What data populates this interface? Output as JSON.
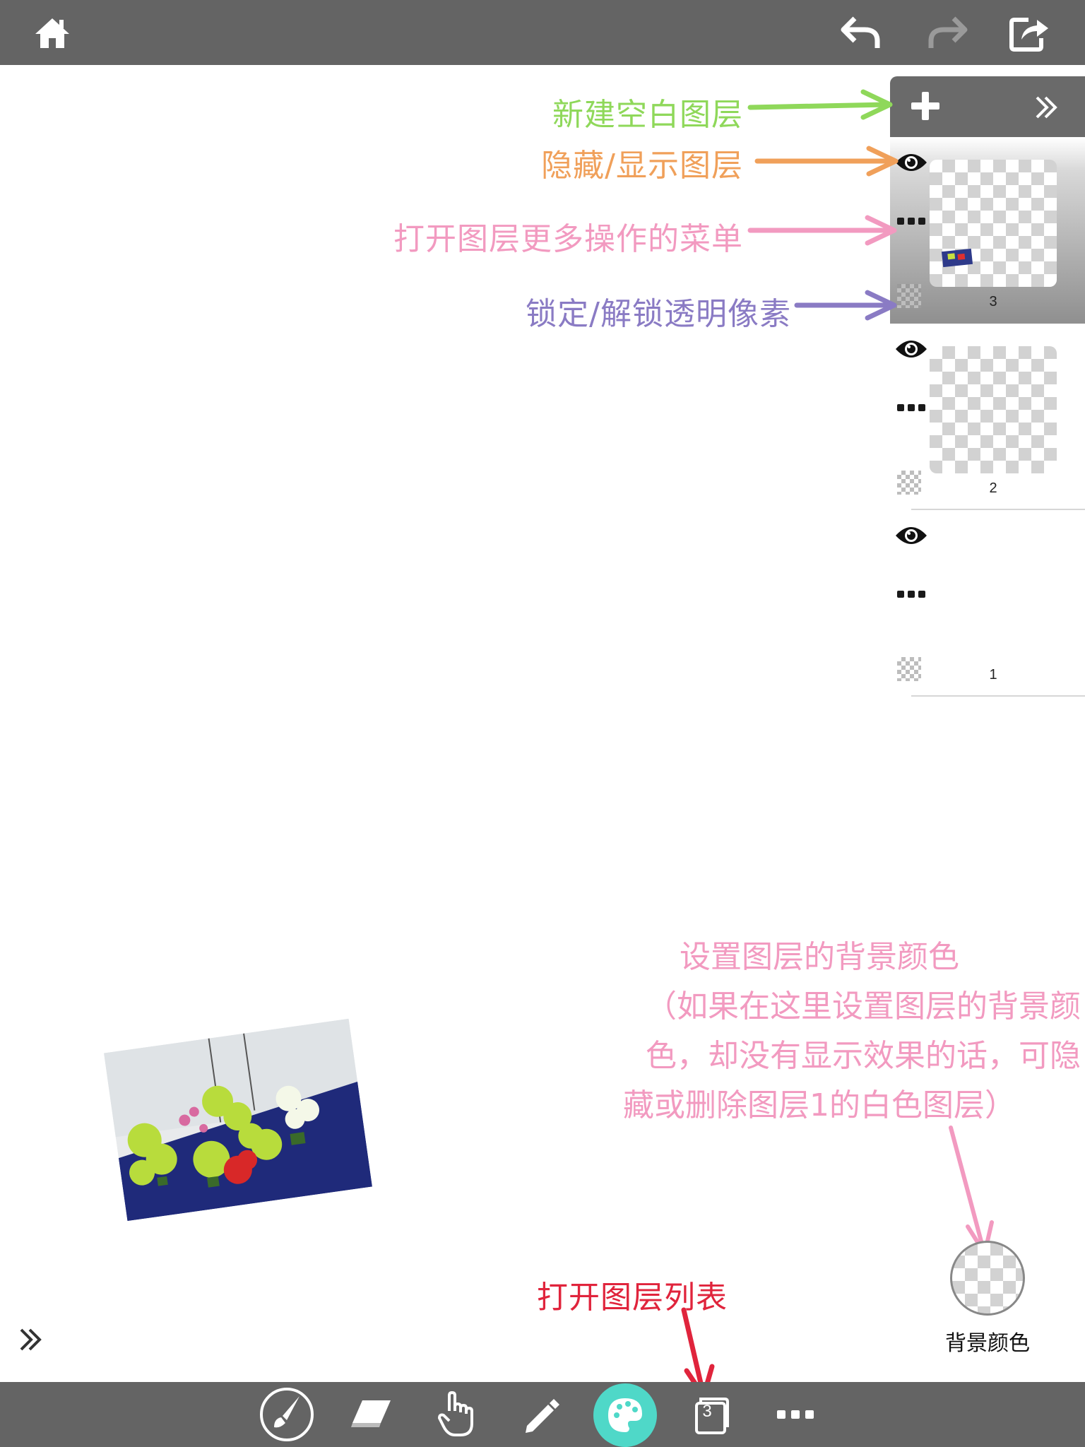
{
  "toolbar_top": {
    "home_icon": "home-icon",
    "undo_icon": "undo-icon",
    "redo_icon": "redo-icon",
    "share_icon": "share-icon"
  },
  "layer_panel": {
    "add_icon": "plus-icon",
    "collapse_icon": "double-chevron-right-icon",
    "layers": [
      {
        "number": "3",
        "selected": true
      },
      {
        "number": "2",
        "selected": false
      },
      {
        "number": "1",
        "selected": false
      }
    ]
  },
  "annotations": {
    "new_layer": "新建空白图层",
    "toggle_visibility": "隐藏/显示图层",
    "more_menu": "打开图层更多操作的菜单",
    "alpha_lock": "锁定/解锁透明像素",
    "bg_color_title": "设置图层的背景颜色",
    "bg_color_note_1": "（如果在这里设置图层的背景颜",
    "bg_color_note_2": "色，却没有显示效果的话，可隐",
    "bg_color_note_3": "藏或删除图层1的白色图层）",
    "open_layer_list": "打开图层列表"
  },
  "annotation_colors": {
    "green": "#8fd85a",
    "orange": "#f0a05a",
    "pink": "#f29ac0",
    "purple": "#8a7bc4",
    "red": "#e0243c"
  },
  "background_color": {
    "label": "背景颜色"
  },
  "toolbar_bottom": {
    "tools": [
      "brush-icon",
      "eraser-icon",
      "hand-icon",
      "pencil-icon",
      "palette-icon",
      "layers-icon",
      "more-icon"
    ],
    "layers_count": "3",
    "active_accent": "#4fd8c8"
  },
  "side_expand_icon": "double-chevron-right-icon"
}
